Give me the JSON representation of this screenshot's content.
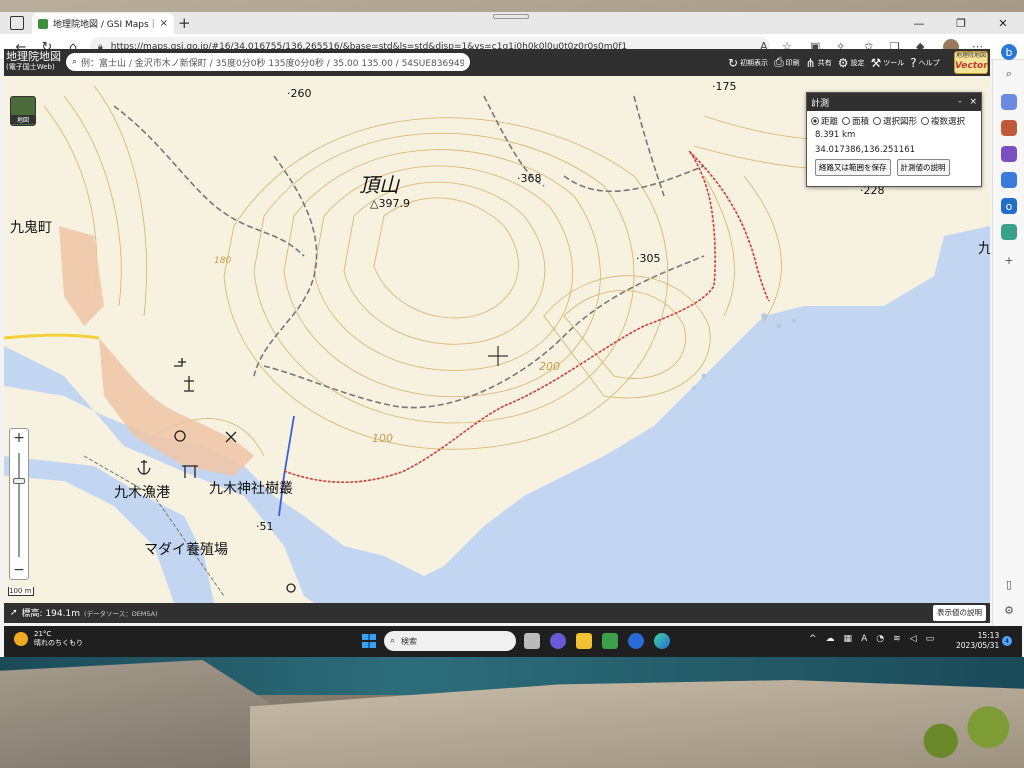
{
  "browser": {
    "tab_title": "地理院地図 / GSI Maps｜国土地",
    "url": "https://maps.gsi.go.jp/#16/34.016755/136.265516/&base=std&ls=std&disp=1&vs=c1g1j0h0k0l0u0t0z0r0s0m0f1",
    "tab_close": "×",
    "new_tab": "+"
  },
  "gsi": {
    "logo_line1": "地理院地図",
    "logo_line2": "(電子国土Web)",
    "search_placeholder": "例：富士山 / 金沢市木ノ新保町 / 35度0分0秒 135度0分0秒 / 35.00 135.00 / 54SUE83694920",
    "menu": [
      {
        "label": "初期表示",
        "icon": "↻"
      },
      {
        "label": "印刷",
        "icon": "⎙"
      },
      {
        "label": "共有",
        "icon": "⋔"
      },
      {
        "label": "設定",
        "icon": "⚙"
      },
      {
        "label": "ツール",
        "icon": "⚒"
      },
      {
        "label": "ヘルプ",
        "icon": "?"
      }
    ],
    "vector_badge_line1": "地理院地図",
    "vector_badge_line2": "Vector",
    "layer_button": "地図"
  },
  "map_labels": {
    "peak_name": "頂山",
    "peak_elevation": "△397.9",
    "town": "九鬼町",
    "harbor": "九木漁港",
    "shrine": "九木神社樹叢",
    "fish_farm": "マダイ養殖場",
    "spot_260": "260",
    "spot_368": "368",
    "spot_305": "305",
    "spot_228": "228",
    "spot_175": "175",
    "spot_51": "51",
    "contour_100": "100",
    "contour_200": "200",
    "contour_180": "180",
    "edge_char": "九",
    "scale": "100 m"
  },
  "measure": {
    "title": "計測",
    "minimize": "-",
    "close": "×",
    "modes": [
      {
        "label": "距離",
        "selected": true
      },
      {
        "label": "面積",
        "selected": false
      },
      {
        "label": "選択図形",
        "selected": false
      },
      {
        "label": "複数選択",
        "selected": false
      }
    ],
    "distance": "8.391 km",
    "coordinate": "34.017386,136.251161",
    "save_button": "経路又は範囲を保存",
    "explain_button": "計測値の説明"
  },
  "footer": {
    "elevation": "標高: 194.1m",
    "source": "(データソース：DEM5A)",
    "explain_button": "表示値の説明"
  },
  "zoom": {
    "in": "+",
    "out": "−",
    "level_fraction": 0.27
  },
  "taskbar": {
    "temperature": "21°C",
    "weather": "晴れのちくもり",
    "search": "検索",
    "time": "15:13",
    "date": "2023/05/31",
    "notifications": "4"
  },
  "colors": {
    "route": "#d43a3a",
    "sea": "#c2d6f2",
    "land": "#f7f2df",
    "contour": "#d9a95a",
    "header": "#303030"
  }
}
